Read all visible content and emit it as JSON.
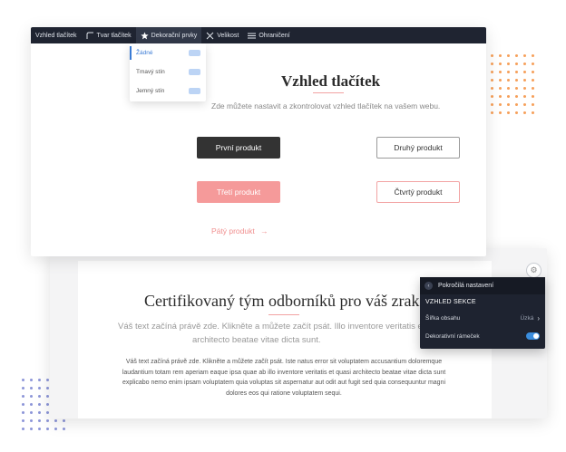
{
  "toolbar": {
    "items": [
      {
        "label": "Vzhled tlačítek",
        "icon": ""
      },
      {
        "label": "Tvar tlačítek",
        "icon": "shape-icon"
      },
      {
        "label": "Dekorační prvky",
        "icon": "star-icon"
      },
      {
        "label": "Velikost",
        "icon": "resize-icon"
      },
      {
        "label": "Ohraničení",
        "icon": "lines-icon"
      }
    ]
  },
  "dropdown": {
    "options": [
      "Žádné",
      "Tmavý stín",
      "Jemný stín"
    ],
    "selected": "Žádné"
  },
  "section1": {
    "title": "Vzhled tlačítek",
    "subtitle": "Zde můžete nastavit a zkontrolovat vzhled tlačítek na vašem webu.",
    "buttons": [
      "První produkt",
      "Druhý produkt",
      "Třetí produkt",
      "Čtvrtý produkt"
    ],
    "link": "Pátý produkt",
    "link_arrow": "→"
  },
  "section2": {
    "title": "Certifikovaný tým odborníků pro váš zrak",
    "subtitle_line1": "Váš text začíná právě zde. Klikněte a můžete začít psát. Illo inventore veritatis et quasi",
    "subtitle_line2": "architecto beatae vitae dicta sunt.",
    "body": "Váš text začíná právě zde. Klikněte a můžete začít psát. Iste natus error sit voluptatem accusantium doloremque laudantium totam rem aperiam eaque ipsa quae ab illo inventore veritatis et quasi architecto beatae vitae dicta sunt explicabo nemo enim ipsam voluptatem quia voluptas sit aspernatur aut odit aut fugit sed quia consequuntur magni dolores eos qui ratione voluptatem sequi."
  },
  "panel": {
    "title": "Pokročilá nastavení",
    "section": "VZHLED SEKCE",
    "content_width_label": "Šířka obsahu",
    "content_width_value": "Úzká",
    "frame_label": "Dekorativní rámeček",
    "frame_on": true
  },
  "colors": {
    "toolbar_bg": "#1f2431",
    "accent_pink": "#f59a9a",
    "dark_button": "#333333",
    "toggle_on": "#3a8dde"
  }
}
